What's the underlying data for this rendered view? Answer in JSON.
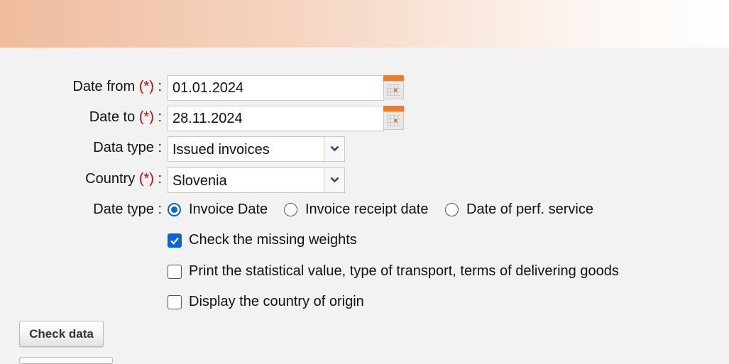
{
  "form": {
    "required_marker": "(*)",
    "date_from": {
      "label": "Date from",
      "value": "01.01.2024"
    },
    "date_to": {
      "label": "Date to",
      "value": "28.11.2024"
    },
    "data_type": {
      "label": "Data type :",
      "selected": "Issued invoices"
    },
    "country": {
      "label": "Country",
      "selected": "Slovenia"
    },
    "colon": ":",
    "date_type": {
      "label": "Date type :",
      "options": [
        {
          "label": "Invoice Date",
          "selected": true
        },
        {
          "label": "Invoice receipt date",
          "selected": false
        },
        {
          "label": "Date of perf. service",
          "selected": false
        }
      ]
    },
    "checkboxes": [
      {
        "label": "Check the missing weights",
        "checked": true
      },
      {
        "label": "Print the statistical value, type of transport, terms of delivering goods",
        "checked": false
      },
      {
        "label": "Display the country of origin",
        "checked": false
      }
    ]
  },
  "buttons": {
    "check_data": "Check data"
  },
  "colors": {
    "accent": "#0a62d6",
    "required": "#d00000",
    "banner_start": "#efbb9d",
    "calendar": "#f07a28"
  },
  "icons": {
    "calendar": "calendar-icon",
    "dropdown": "chevron-down-icon"
  }
}
